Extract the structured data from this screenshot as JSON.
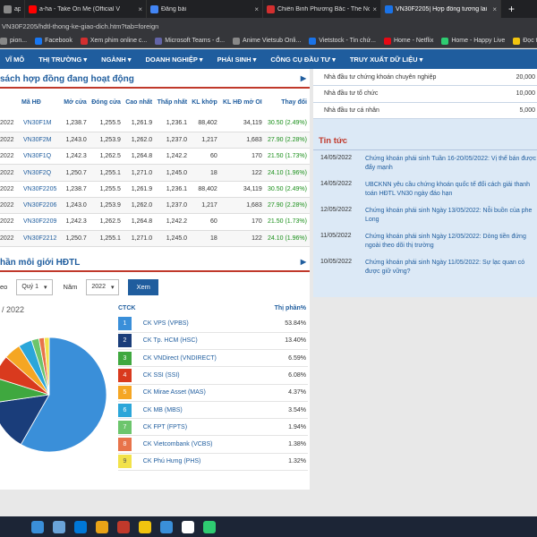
{
  "browser": {
    "tabs": [
      {
        "label": "apion...",
        "color": "#888888",
        "width": 28,
        "active": false
      },
      {
        "label": "a-ha - Take On Me (Official V",
        "color": "#ff0000",
        "width": 136,
        "active": false
      },
      {
        "label": "Đăng bài",
        "color": "#4285f4",
        "width": 130,
        "active": false
      },
      {
        "label": "Chiến Binh Phương Bắc - The No",
        "color": "#d32f2f",
        "width": 132,
        "active": false
      },
      {
        "label": "VN30F2205| Hợp đồng tương lai",
        "color": "#1a73e8",
        "width": 134,
        "active": true
      }
    ],
    "tab_close": "×",
    "new_tab": "+",
    "url": "VN30F2205/hdtl-thong-ke-giao-dich.htm?tab=foreign",
    "bookmarks": [
      {
        "label": "pion...",
        "color": "#888888"
      },
      {
        "label": "Facebook",
        "color": "#1877f2"
      },
      {
        "label": "Xem phim online c...",
        "color": "#d32f2f"
      },
      {
        "label": "Microsoft Teams - đ...",
        "color": "#6264a7"
      },
      {
        "label": "Anime Vietsub Onli...",
        "color": "#888888"
      },
      {
        "label": "Vietstock - Tin chứ...",
        "color": "#1a73e8"
      },
      {
        "label": "Home - Netflix",
        "color": "#e50914"
      },
      {
        "label": "Home - Happy Live",
        "color": "#2ecc71"
      },
      {
        "label": "Đọc truyệ",
        "color": "#f1c40f"
      }
    ]
  },
  "nav": {
    "items": [
      "VĨ MÔ",
      "THỊ TRƯỜNG ▾",
      "NGÀNH ▾",
      "DOANH NGHIỆP ▾",
      "PHÁI SINH ▾",
      "CÔNG CỤ ĐẦU TƯ ▾",
      "TRUY XUẤT DỮ LIỆU ▾"
    ]
  },
  "contracts": {
    "title": "sách hợp đồng đang hoạt động",
    "headers": [
      "",
      "Mã HĐ",
      "Mở cửa",
      "Đóng cửa",
      "Cao nhất",
      "Thấp nhất",
      "KL khớp",
      "KL HĐ mở OI",
      "Thay đổi"
    ],
    "rows": [
      [
        "2022",
        "VN30F1M",
        "1,238.7",
        "1,255.5",
        "1,261.9",
        "1,236.1",
        "88,402",
        "34,119",
        "30.50 (2.49%)"
      ],
      [
        "2022",
        "VN30F2M",
        "1,243.0",
        "1,253.9",
        "1,262.0",
        "1,237.0",
        "1,217",
        "1,683",
        "27.90 (2.28%)"
      ],
      [
        "2022",
        "VN30F1Q",
        "1,242.3",
        "1,262.5",
        "1,264.8",
        "1,242.2",
        "60",
        "170",
        "21.50 (1.73%)"
      ],
      [
        "2022",
        "VN30F2Q",
        "1,250.7",
        "1,255.1",
        "1,271.0",
        "1,245.0",
        "18",
        "122",
        "24.10 (1.96%)"
      ],
      [
        "2022",
        "VN30F2205",
        "1,238.7",
        "1,255.5",
        "1,261.9",
        "1,236.1",
        "88,402",
        "34,119",
        "30.50 (2.49%)"
      ],
      [
        "2022",
        "VN30F2206",
        "1,243.0",
        "1,253.9",
        "1,262.0",
        "1,237.0",
        "1,217",
        "1,683",
        "27.90 (2.28%)"
      ],
      [
        "2022",
        "VN30F2209",
        "1,242.3",
        "1,262.5",
        "1,264.8",
        "1,242.2",
        "60",
        "170",
        "21.50 (1.73%)"
      ],
      [
        "2022",
        "VN30F2212",
        "1,250.7",
        "1,255.1",
        "1,271.0",
        "1,245.0",
        "18",
        "122",
        "24.10 (1.96%)"
      ]
    ]
  },
  "market_share": {
    "title": "hần môi giới HĐTL",
    "filter_label": "eo",
    "quarter": "Quý 1",
    "year_label": "Năm",
    "year": "2022",
    "button": "Xem",
    "period": "/ 2022",
    "col_broker": "CTCK",
    "col_share": "Thị phần%",
    "brokers": [
      {
        "n": "1",
        "name": "CK VPS (VPBS)",
        "pct": "53.84%",
        "color": "#3a8fd9"
      },
      {
        "n": "2",
        "name": "CK Tp. HCM (HSC)",
        "pct": "13.40%",
        "color": "#1a3d7a"
      },
      {
        "n": "3",
        "name": "CK VNDirect (VNDIRECT)",
        "pct": "6.59%",
        "color": "#3fa83f"
      },
      {
        "n": "4",
        "name": "CK SSI (SSI)",
        "pct": "6.08%",
        "color": "#d93a1e"
      },
      {
        "n": "5",
        "name": "CK Mirae Asset (MAS)",
        "pct": "4.37%",
        "color": "#f5a623"
      },
      {
        "n": "6",
        "name": "CK MB (MBS)",
        "pct": "3.54%",
        "color": "#2ba6d9"
      },
      {
        "n": "7",
        "name": "CK FPT (FPTS)",
        "pct": "1.94%",
        "color": "#6cc56c"
      },
      {
        "n": "8",
        "name": "CK Vietcombank (VCBS)",
        "pct": "1.38%",
        "color": "#e8734a"
      },
      {
        "n": "9",
        "name": "CK Phú Hưng (PHS)",
        "pct": "1.32%",
        "color": "#f2e24a"
      }
    ]
  },
  "chart_data": {
    "type": "pie",
    "categories": [
      "CK VPS (VPBS)",
      "CK Tp. HCM (HSC)",
      "CK VNDirect (VNDIRECT)",
      "CK SSI (SSI)",
      "CK Mirae Asset (MAS)",
      "CK MB (MBS)",
      "CK FPT (FPTS)",
      "CK Vietcombank (VCBS)",
      "CK Phú Hưng (PHS)"
    ],
    "values": [
      53.84,
      13.4,
      6.59,
      6.08,
      4.37,
      3.54,
      1.94,
      1.38,
      1.32
    ],
    "colors": [
      "#3a8fd9",
      "#1a3d7a",
      "#3fa83f",
      "#d93a1e",
      "#f5a623",
      "#2ba6d9",
      "#6cc56c",
      "#e8734a",
      "#f2e24a"
    ],
    "title": "/ 2022"
  },
  "investors": {
    "rows": [
      {
        "label": "Nhà đầu tư chứng khoán chuyên nghiệp",
        "value": "20,000"
      },
      {
        "label": "Nhà đầu tư tổ chức",
        "value": "10,000"
      },
      {
        "label": "Nhà đầu tư cá nhân",
        "value": "5,000"
      }
    ]
  },
  "news": {
    "title": "Tin tức",
    "items": [
      {
        "date": "14/05/2022",
        "text": "Chứng khoán phái sinh Tuần 16-20/05/2022: Vị thế bán được đẩy mạnh"
      },
      {
        "date": "14/05/2022",
        "text": "UBCKNN yêu cầu chứng khoán quốc tế đổi cách giải thanh toán HĐTL VN30 ngày đáo hạn"
      },
      {
        "date": "12/05/2022",
        "text": "Chứng khoán phái sinh Ngày 13/05/2022: Nỗi buồn của phe Long"
      },
      {
        "date": "11/05/2022",
        "text": "Chứng khoán phái sinh Ngày 12/05/2022: Dòng tiền đứng ngoài theo dõi thị trường"
      },
      {
        "date": "10/05/2022",
        "text": "Chứng khoán phái sinh Ngày 11/05/2022: Sự lạc quan có được giữ vững?"
      }
    ]
  },
  "taskbar": {
    "apps": [
      "#3a8fd9",
      "#6aa4d9",
      "#0078d7",
      "#e8a317",
      "#c0392b",
      "#f1c40f",
      "#3a8fd9",
      "#ffffff",
      "#2ecc71"
    ]
  }
}
